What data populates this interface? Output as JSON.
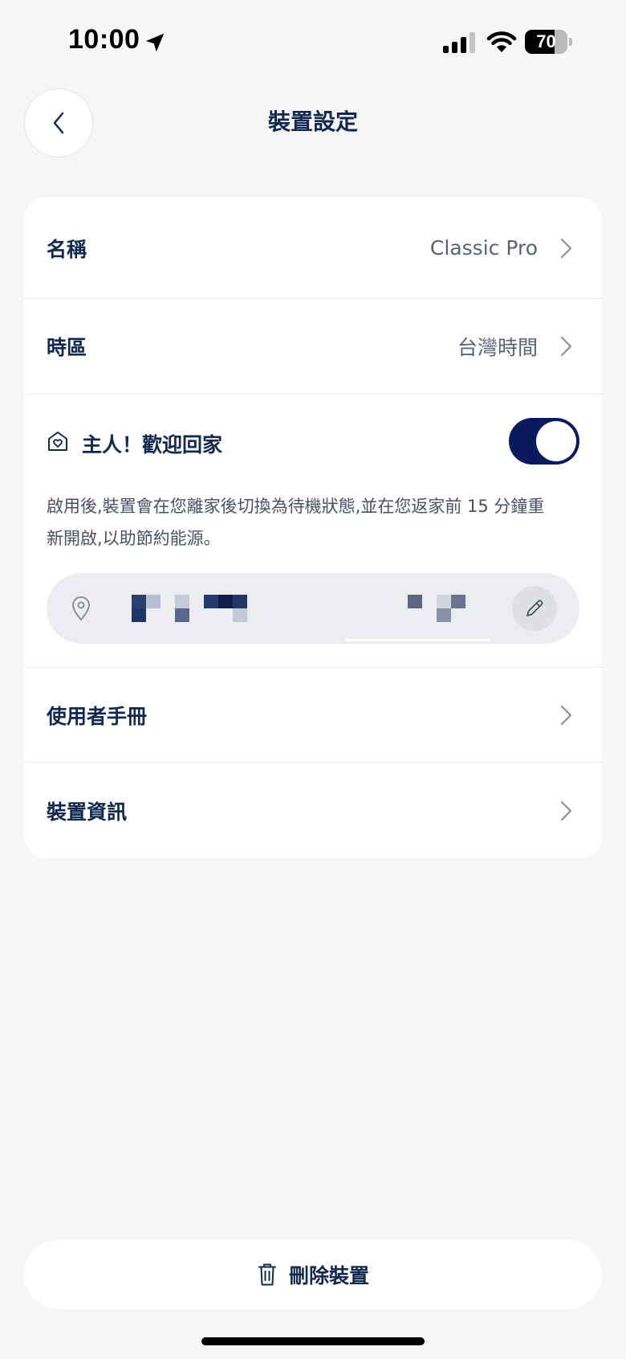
{
  "status_bar": {
    "time": "10:00",
    "battery_level": "70",
    "battery_fraction": 0.7
  },
  "header": {
    "title": "裝置設定",
    "back_icon": "chevron-left-icon"
  },
  "settings": {
    "name_label": "名稱",
    "name_value": "Classic Pro",
    "timezone_label": "時區",
    "timezone_value": "台灣時間",
    "welcome_home": {
      "title": "主人！歡迎回家",
      "enabled": true,
      "description_line1": "啟用後,裝置會在您離家後切換為待機狀態,並在您返家前 15 分鐘重",
      "description_line2": "新開啟,以助節約能源。"
    },
    "manual_label": "使用者手冊",
    "device_info_label": "裝置資訊"
  },
  "footer": {
    "delete_label": "刪除裝置"
  },
  "colors": {
    "accent": "#0b1a5c",
    "text_primary": "#13284f",
    "background": "#f6f6f7"
  }
}
